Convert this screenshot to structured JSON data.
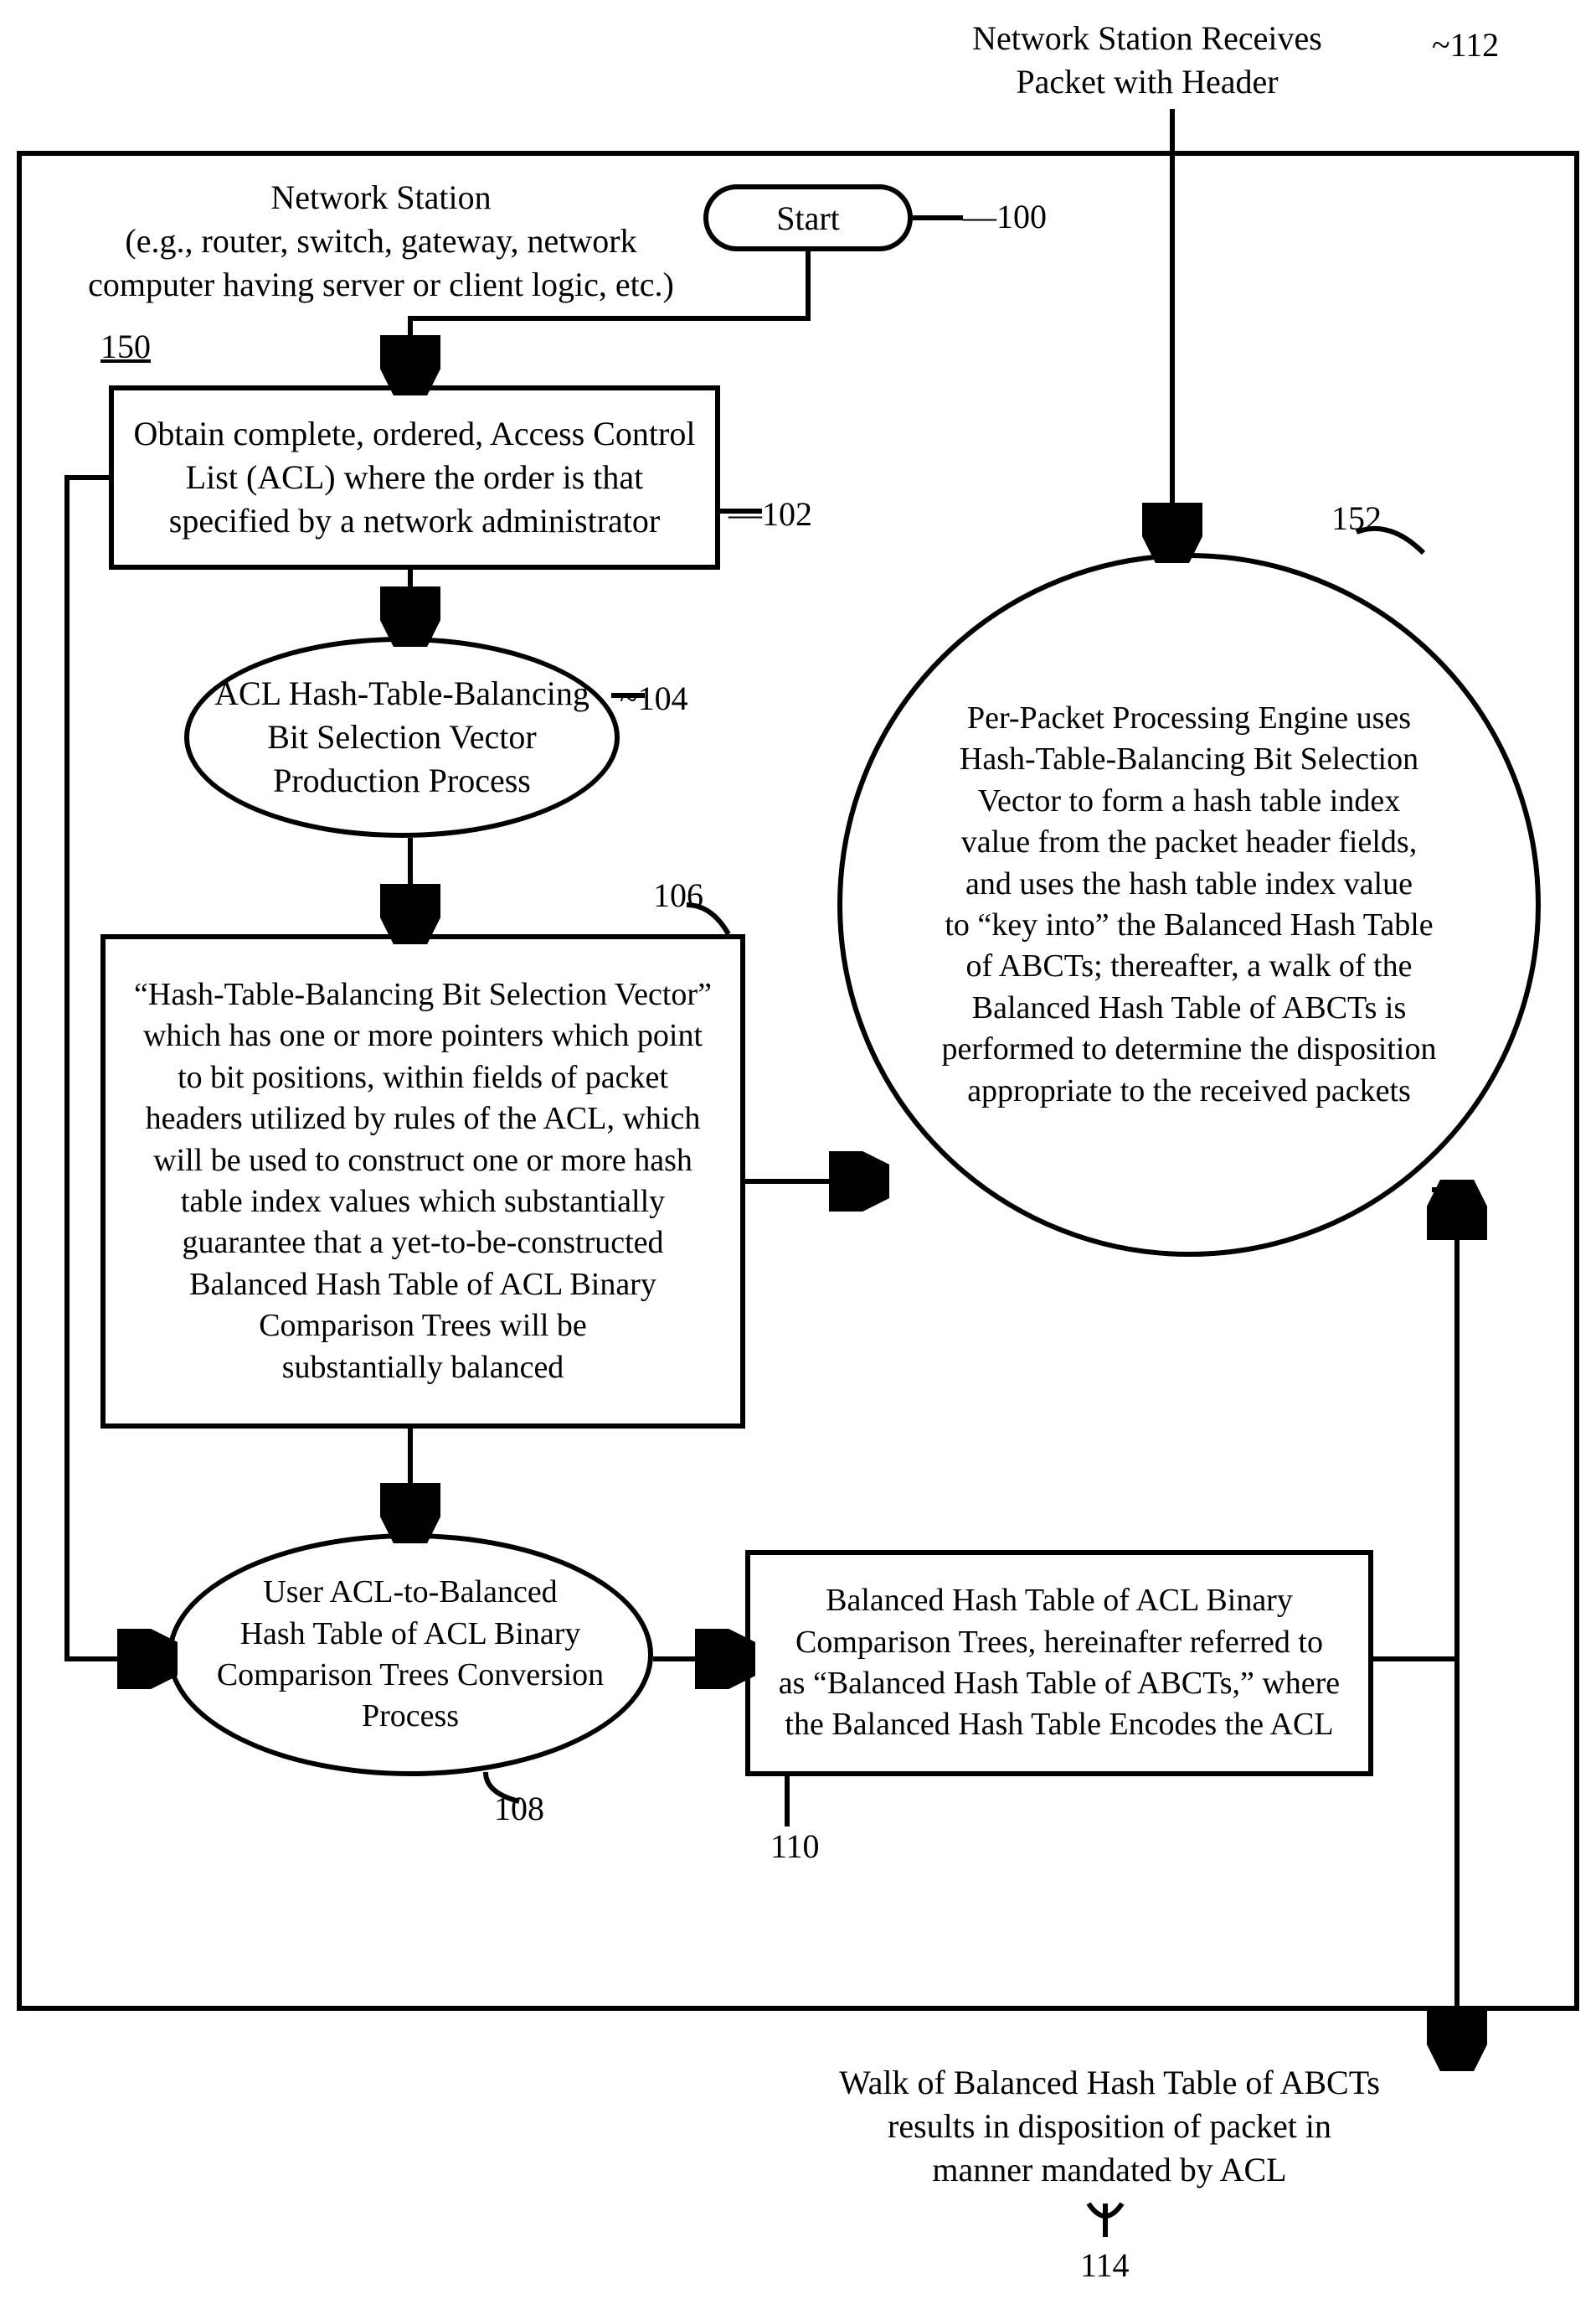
{
  "nodes": {
    "n112": {
      "text": "Network Station Receives\nPacket with Header",
      "ref": "112"
    },
    "title150": {
      "text": "Network Station\n(e.g., router, switch, gateway, network\ncomputer having server or client logic, etc.)",
      "ref": "150"
    },
    "n100": {
      "text": "Start",
      "ref": "100"
    },
    "n102": {
      "text": "Obtain complete, ordered, Access Control\nList (ACL) where the order is that\nspecified by a network administrator",
      "ref": "102"
    },
    "n104": {
      "text": "ACL Hash-Table-Balancing\nBit Selection Vector\nProduction Process",
      "ref": "104"
    },
    "n106": {
      "text": "“Hash-Table-Balancing Bit Selection Vector”\nwhich has one or more pointers which point\nto bit positions, within fields of packet\nheaders utilized by rules of the ACL, which\nwill be used to construct one or more hash\ntable index values which substantially\nguarantee that a yet-to-be-constructed\nBalanced Hash Table of ACL Binary\nComparison Trees will be\nsubstantially balanced",
      "ref": "106"
    },
    "n152": {
      "text": "Per-Packet Processing Engine uses\nHash-Table-Balancing Bit Selection\nVector to form a hash table index\nvalue from the packet header fields,\nand uses the hash table index value\nto “key into” the Balanced Hash Table\nof ABCTs; thereafter, a walk of the\nBalanced Hash Table of ABCTs is\nperformed to determine the disposition\nappropriate to the received packets",
      "ref": "152"
    },
    "n108": {
      "text": "User ACL-to-Balanced\nHash Table of ACL Binary\nComparison Trees Conversion\nProcess",
      "ref": "108"
    },
    "n110": {
      "text": "Balanced Hash Table of ACL Binary\nComparison Trees, hereinafter referred to\nas “Balanced Hash Table of ABCTs,” where\nthe Balanced Hash Table Encodes the ACL",
      "ref": "110"
    },
    "n114": {
      "text": "Walk of Balanced Hash Table of ABCTs\nresults in disposition of packet in\nmanner mandated by ACL",
      "ref": "114"
    }
  }
}
